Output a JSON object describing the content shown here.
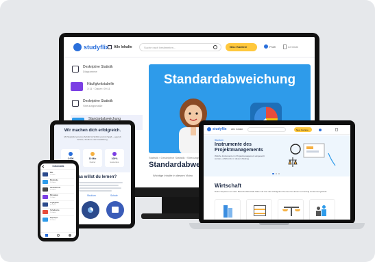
{
  "colors": {
    "background": "#e6e8eb",
    "brand_blue": "#2a6fdb",
    "hero_blue": "#2e9bea",
    "cta_yellow": "#ffc83d",
    "lavender": "#eef0fb"
  },
  "desktop": {
    "brand": "studyflix",
    "nav_menu": "Alle Inhalte",
    "search_placeholder": "Suche nach bestimmten...",
    "cta": "Neu: Karriere",
    "user": "Profil",
    "bookmark": "Lernliste",
    "sidebar": [
      {
        "title": "Deskriptive Statistik",
        "sub": "Diagramme"
      },
      {
        "title": "Häufigkeitstabelle",
        "sub": "3:11 · Dauer: 09:11"
      },
      {
        "title": "Deskriptive Statistik",
        "sub": "Streuungsmaße"
      },
      {
        "title": "Standardabweichung",
        "sub": "4:15 · Dauer: 05:16"
      }
    ],
    "hero_title": "Standardabweichung",
    "breadcrumb": "Statistik › Deskriptive Statistik › Streuungsmaße",
    "page_title": "Standardabweichung",
    "snippet": "Wichtige Inhalte in diesem Video"
  },
  "laptop": {
    "brand": "studyflix",
    "nav_menu": "Alle Inhalte",
    "cta": "Neu: Karriere",
    "kicker": "Studium",
    "hero_title_line1": "Instrumente des",
    "hero_title_line2": "Projektmanagements",
    "hero_text": "Welche Instrumente im Projektmanagement eingesetzt werden, erfährst du in diesem Beitrag.",
    "section_title": "Wirtschaft",
    "section_sub": "Deine Experten aus dem Bereich Wirtschaft haben dir hier die wichtigsten Themen für deinen Lernerfolg zusammengestellt."
  },
  "tablet": {
    "headline": "Wir machen dich erfolgreich.",
    "intro": "Mit Studyflix lernst du Schritt für Schritt und mit Spaß – egal ob Schule, Studium oder Ausbildung.",
    "stats": [
      {
        "value": "2.000",
        "label": "Lernvideos"
      },
      {
        "value": "10 Mio",
        "label": "Nutzer"
      },
      {
        "value": "100%",
        "label": "kostenlos"
      }
    ],
    "question": "Was willst du lernen?",
    "tabs": [
      "Studium",
      "Schule"
    ]
  },
  "phone": {
    "title": "Informatik",
    "items": [
      {
        "title": "Bits",
        "sub": "1 Video"
      },
      {
        "title": "Binärcode",
        "sub": "3 Videos"
      },
      {
        "title": "Hexadezimal",
        "sub": "2 Videos"
      },
      {
        "title": "Bitmasken",
        "sub": "1 Video"
      },
      {
        "title": "Logikgatter",
        "sub": "4 Videos"
      },
      {
        "title": "Schaltnetze",
        "sub": "2 Videos"
      },
      {
        "title": "Flip-Flops",
        "sub": "3 Videos"
      }
    ]
  }
}
